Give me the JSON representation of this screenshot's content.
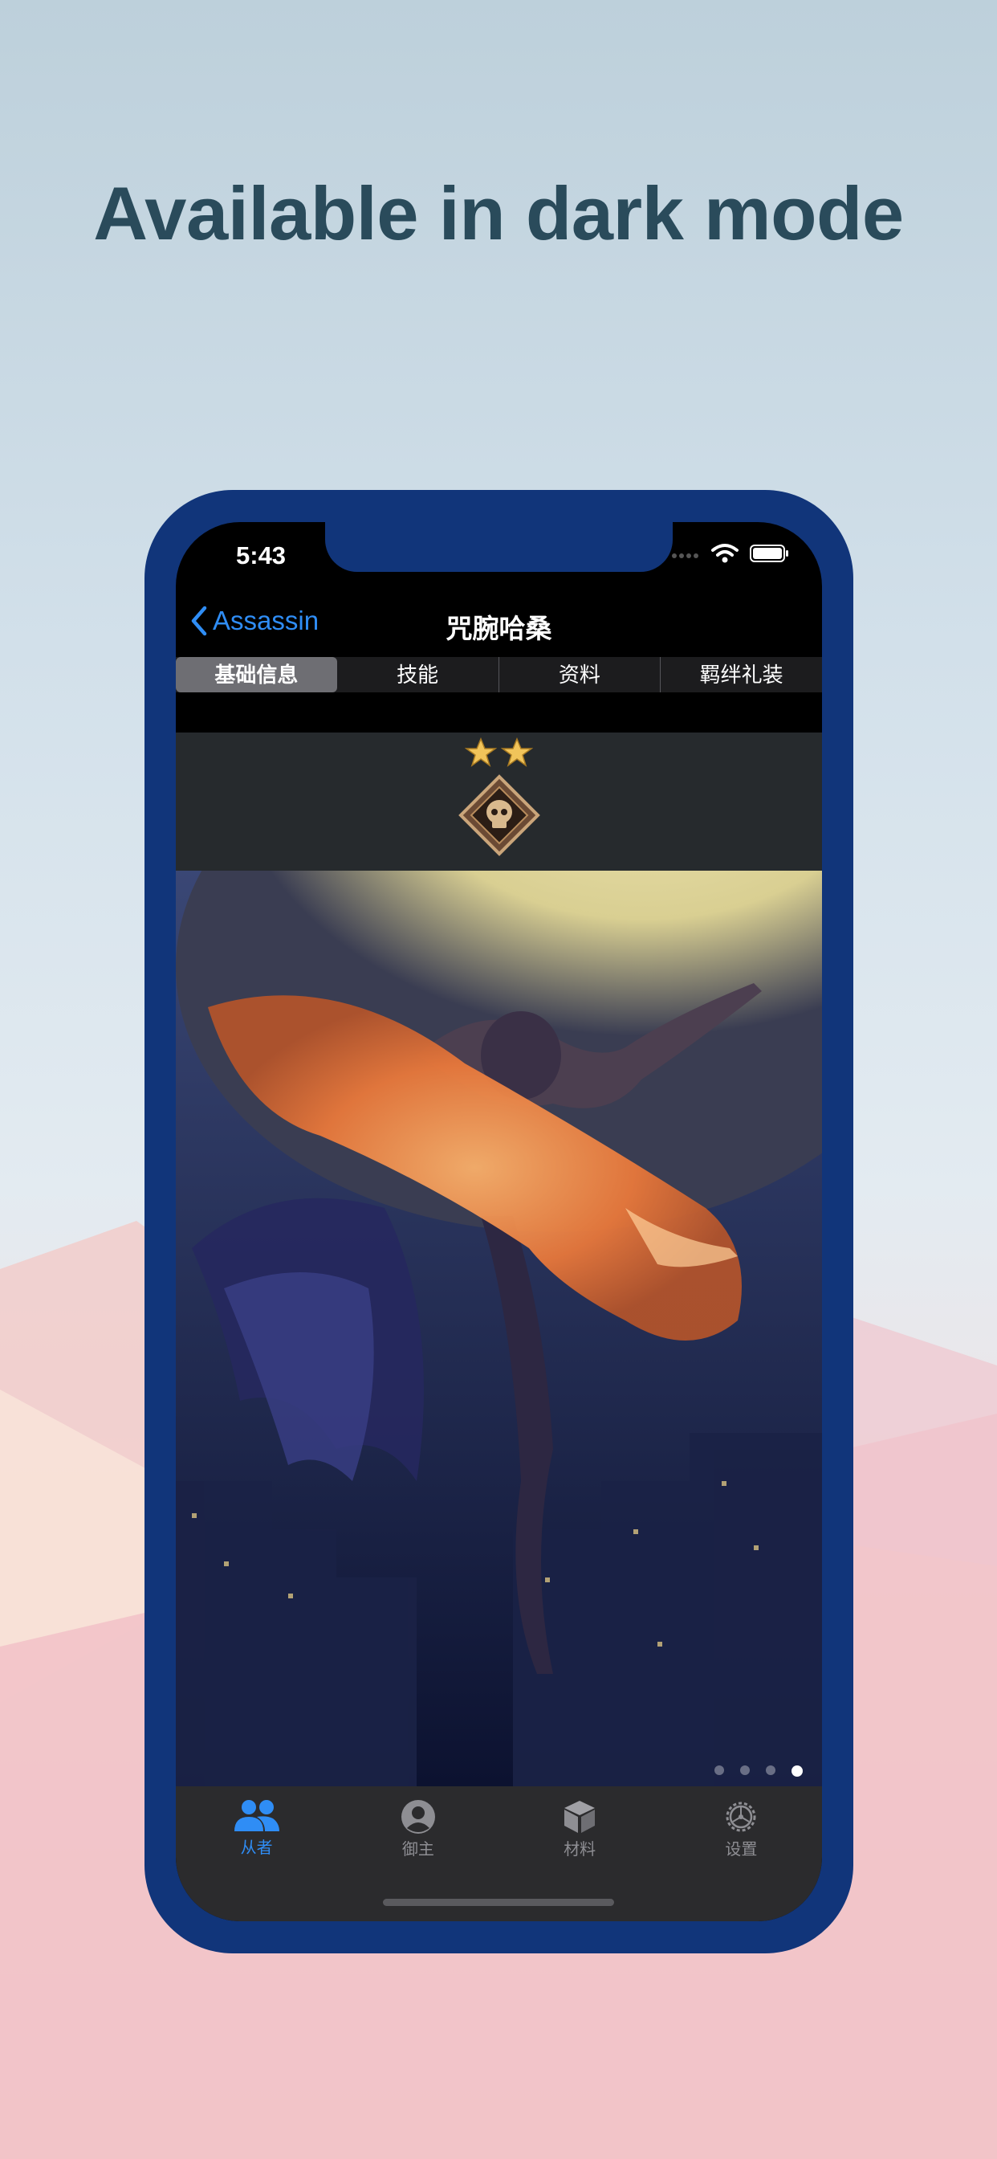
{
  "headline": "Available in dark mode",
  "status": {
    "time": "5:43"
  },
  "nav": {
    "back_label": "Assassin",
    "title": "咒腕哈桑"
  },
  "segments": [
    {
      "label": "基础信息",
      "active": true
    },
    {
      "label": "技能",
      "active": false
    },
    {
      "label": "资料",
      "active": false
    },
    {
      "label": "羁绊礼装",
      "active": false
    }
  ],
  "servant": {
    "rarity_stars": 2,
    "class_icon": "assassin-skull-icon"
  },
  "carousel": {
    "pages": 4,
    "current": 4
  },
  "tabbar": [
    {
      "label": "从者",
      "icon": "users-icon",
      "active": true
    },
    {
      "label": "御主",
      "icon": "person-circle-icon",
      "active": false
    },
    {
      "label": "材料",
      "icon": "box-icon",
      "active": false
    },
    {
      "label": "设置",
      "icon": "gear-icon",
      "active": false
    }
  ],
  "colors": {
    "accent": "#2f8df5",
    "phone_frame": "#11357a",
    "headline": "#2a4b5b"
  }
}
